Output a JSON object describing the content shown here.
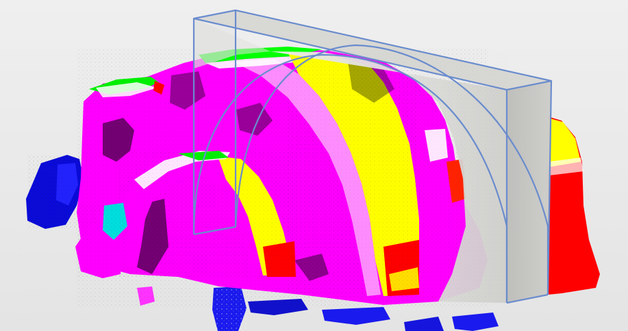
{
  "viewport": {
    "background": "#e8e8e8",
    "palette": {
      "magenta": "#ff00ff",
      "yellow": "#ffff00",
      "red": "#ff0000",
      "blue": "#0000ff",
      "green": "#00ff00",
      "cyan": "#00e5e5",
      "section_plane": "#d9d9d6",
      "wireframe": "#6a8ccd"
    },
    "icons": {
      "point-cloud": "point-cloud-icon",
      "section-box": "section-box-icon"
    }
  }
}
